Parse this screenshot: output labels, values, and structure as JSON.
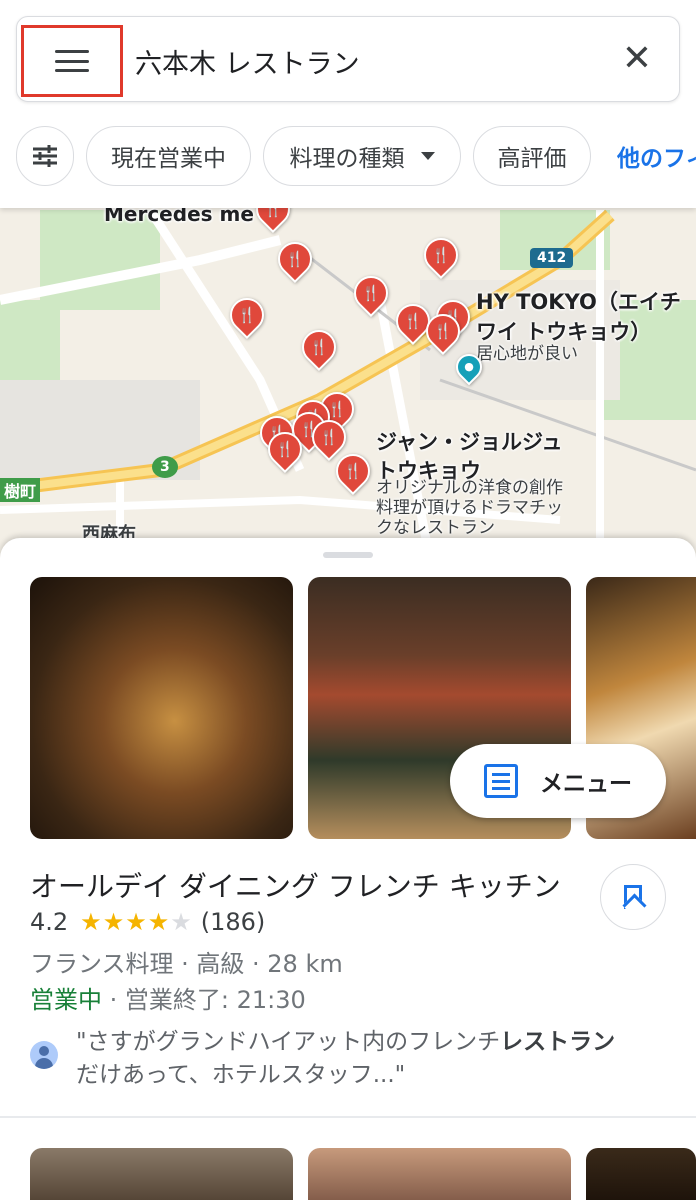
{
  "search": {
    "query": "六本木 レストラン",
    "clear_label": "✕"
  },
  "filters": {
    "open_now": "現在営業中",
    "cuisine": "料理の種類",
    "top_rated": "高評価",
    "more": "他のフィ"
  },
  "map": {
    "labels": {
      "mercedes": "Mercedes me",
      "hy_tokyo_line1": "HY TOKYO（エイチ",
      "hy_tokyo_line2": "ワイ トウキョウ）",
      "hy_tokyo_desc": "居心地が良い",
      "jean_line1": "ジャン・ジョルジュ",
      "jean_line2": "トウキョウ",
      "jean_desc1": "オリジナルの洋食の創作",
      "jean_desc2": "料理が頂けるドラマチッ",
      "jean_desc3": "クなレストラン",
      "nishiazabu": "西麻布",
      "edge_label": "樹町",
      "route_412": "412",
      "route_3": "3"
    },
    "pin_glyph": "🍴",
    "colors": {
      "pin": "#e0483b",
      "road_major": "#f6c453",
      "water_parks": "#c6e3b8"
    }
  },
  "place": {
    "menu_label": "メニュー",
    "name": "オールデイ ダイニング フレンチ キッチン",
    "rating": "4.2",
    "rating_value": 4.2,
    "stars_on": "★★★★",
    "stars_off": "★",
    "reviews": "(186)",
    "category": "フランス料理 · 高級 · 28 km",
    "open_status": "営業中",
    "hours": " · 営業終了: 21:30",
    "review_prefix": "\"さすがグランドハイアット内のフレンチ",
    "review_highlight": "レストラン",
    "review_suffix": "だけあって、ホテルスタッフ...\""
  },
  "icons": {
    "menu": "hamburger-menu-icon",
    "clear": "close-icon",
    "filter": "sliders-icon",
    "save": "bookmark-icon",
    "menu_list": "list-icon"
  }
}
